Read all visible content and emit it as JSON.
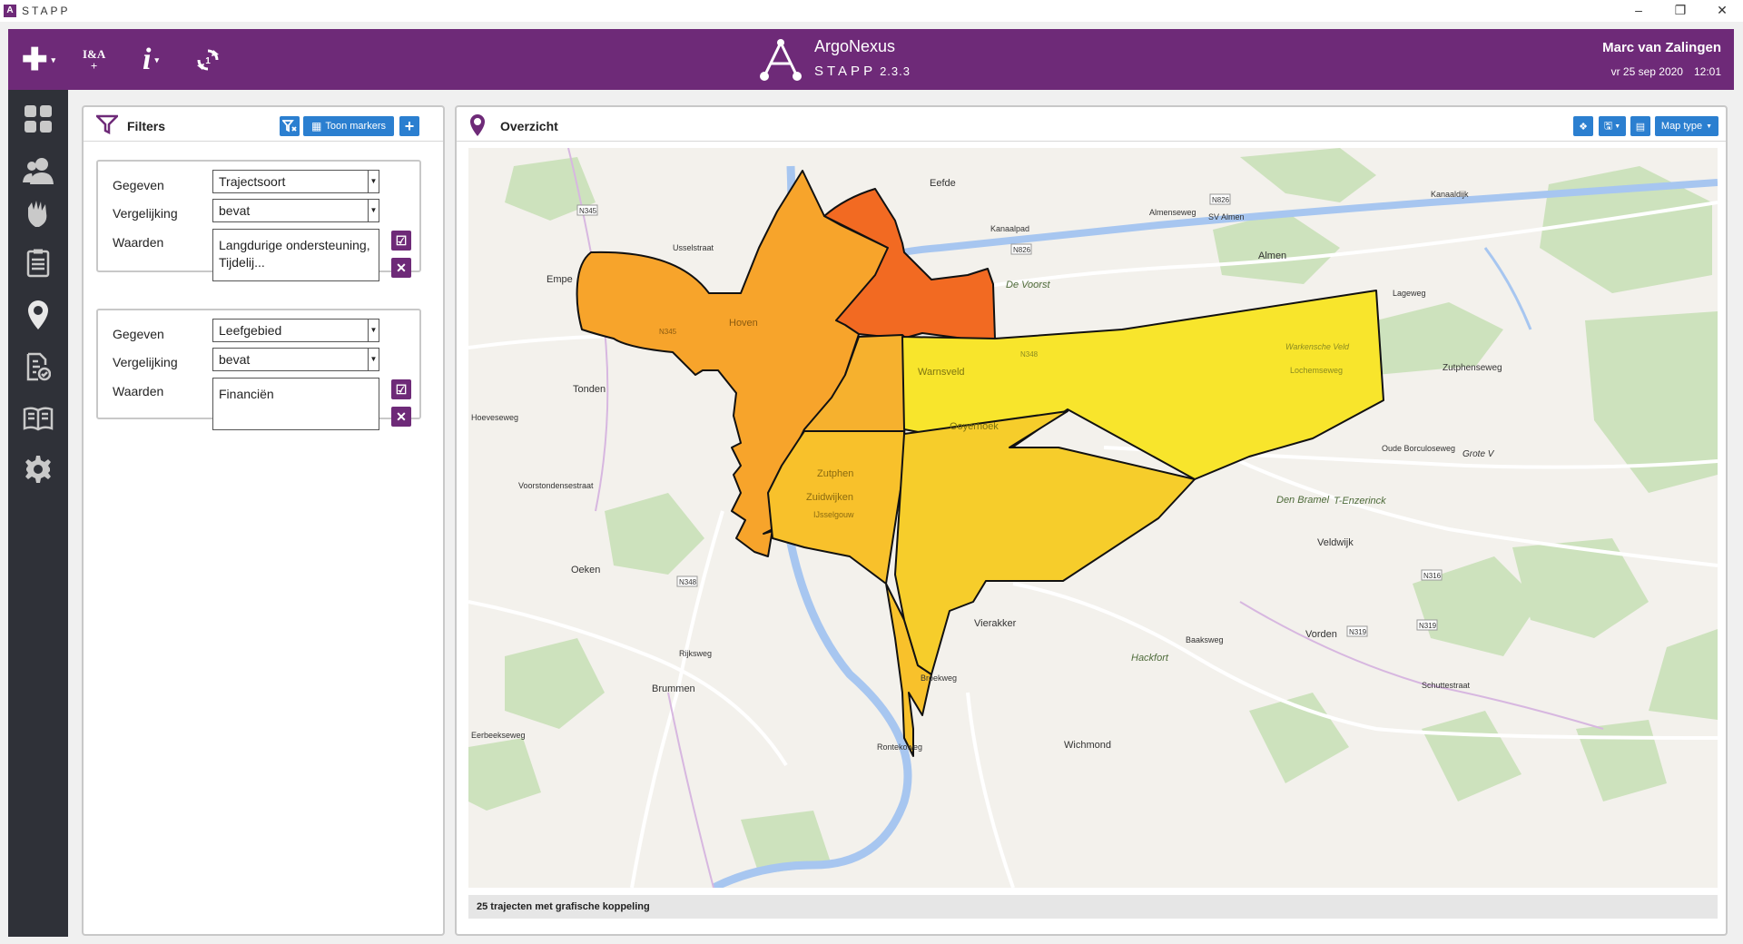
{
  "window": {
    "app_name": "STAPP",
    "app_icon_glyph": "A"
  },
  "topbar": {
    "ia_label_line1": "I&A",
    "ia_label_line2": "+",
    "info_glyph": "i",
    "brand_name": "ArgoNexus",
    "brand_sub": "STAPP",
    "brand_version": "2.3.3",
    "user_name": "Marc van Zalingen",
    "date": "vr 25 sep 2020",
    "time": "12:01"
  },
  "sidebar": {
    "items": [
      "dashboard-icon",
      "people-icon",
      "hands-icon",
      "document-list-icon",
      "map-pin-icon",
      "document-check-icon",
      "book-icon",
      "gear-icon"
    ]
  },
  "filters": {
    "title": "Filters",
    "show_markers_label": "Toon markers",
    "boxes": [
      {
        "gegeven_label": "Gegeven",
        "gegeven_value": "Trajectsoort",
        "vergelijking_label": "Vergelijking",
        "vergelijking_value": "bevat",
        "waarden_label": "Waarden",
        "waarden_value": "Langdurige ondersteuning, Tijdelij..."
      },
      {
        "gegeven_label": "Gegeven",
        "gegeven_value": "Leefgebied",
        "vergelijking_label": "Vergelijking",
        "vergelijking_value": "bevat",
        "waarden_label": "Waarden",
        "waarden_value": "Financiën"
      }
    ]
  },
  "map": {
    "title": "Overzicht",
    "map_type_label": "Map type",
    "status_text": "25 trajecten met grafische koppeling",
    "place_labels": {
      "eefde": "Eefde",
      "empe": "Empe",
      "almen": "Almen",
      "hoven": "Hoven",
      "tonden": "Tonden",
      "warnsveld": "Warnsveld",
      "ooyerhoek": "Ooyerhoek",
      "zutphen": "Zutphen",
      "zuidwijken": "Zuidwijken",
      "oeken": "Oeken",
      "vierakker": "Vierakker",
      "veldwijk": "Veldwijk",
      "vorden": "Vorden",
      "brummen": "Brummen",
      "wichmond": "Wichmond",
      "hackfort": "Hackfort",
      "de_voorst": "De Voorst",
      "den_bramel": "Den Bramel",
      "t_enzerinck": "T-Enzerinck",
      "sv_almen": "SV Almen",
      "kanaalpad": "Kanaalpad",
      "kanaaldijk": "Kanaaldijk",
      "almenseweg": "Almenseweg",
      "lageweg": "Lageweg",
      "zutphenseweg": "Zutphenseweg",
      "oude_borculoseweg": "Oude Borculoseweg",
      "grote": "Grote V",
      "lochemseweg": "Lochemseweg",
      "warkensche_veld": "Warkensche Veld",
      "ijsselgouw": "IJsselgouw",
      "hoeveseweg": "Hoeveseweg",
      "voorstondensestraat": "Voorstondensestraat",
      "rijksweg": "Rijksweg",
      "eerbeekseweg": "Eerbeekseweg",
      "broekweg": "Broekweg",
      "rontekoweg": "Rontekoweg",
      "baaksweg": "Baaksweg",
      "schuttestraat": "Schuttestraat",
      "ussel": "Usselstraat"
    },
    "road_labels": {
      "n345a": "N345",
      "n345b": "N345",
      "n826a": "N826",
      "n826b": "N826",
      "n348": "N348",
      "n316": "N316",
      "n319a": "N319",
      "n319b": "N319",
      "n348b": "N348"
    },
    "region_colors": {
      "red": "#f26a22",
      "orange": "#f7a42b",
      "lightorange": "#f8bb2a",
      "yellow": "#f8e82a",
      "gold": "#f6cd2b"
    }
  }
}
